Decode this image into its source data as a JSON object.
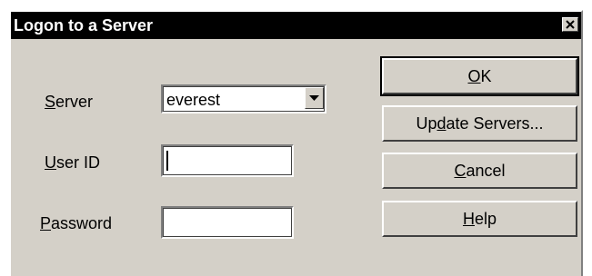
{
  "window": {
    "title": "Logon to a Server",
    "close_icon": "close-icon"
  },
  "form": {
    "server_label_mnemonic": "S",
    "server_label_rest": "erver",
    "server_value": "everest",
    "userid_label_mnemonic": "U",
    "userid_label_rest": "ser ID",
    "userid_value": "",
    "password_label_mnemonic": "P",
    "password_label_rest": "assword",
    "password_value": ""
  },
  "buttons": {
    "ok_mnemonic": "O",
    "ok_rest": "K",
    "update_pre": "Up",
    "update_mnemonic": "d",
    "update_rest": "ate Servers...",
    "cancel_mnemonic": "C",
    "cancel_rest": "ancel",
    "help_mnemonic": "H",
    "help_rest": "elp"
  }
}
